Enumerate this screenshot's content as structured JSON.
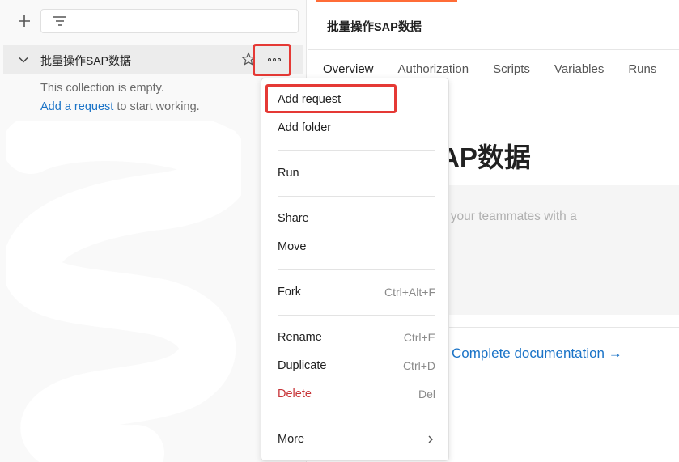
{
  "sidebar": {
    "collection_name": "批量操作SAP数据",
    "empty_message": "This collection is empty.",
    "add_request_link": "Add a request",
    "empty_suffix": " to start working."
  },
  "main": {
    "title": "批量操作SAP数据",
    "tabs": [
      {
        "label": "Overview"
      },
      {
        "label": "Authorization"
      },
      {
        "label": "Scripts"
      },
      {
        "label": "Variables"
      },
      {
        "label": "Runs"
      }
    ],
    "big_title": "批量操作SAP数据",
    "description_placeholder": "Make things easier for your teammates with a",
    "doc_link": "Complete documentation →"
  },
  "context_menu": {
    "items": [
      {
        "label": "Add request",
        "shortcut": ""
      },
      {
        "label": "Add folder",
        "shortcut": ""
      },
      {
        "label": "Run",
        "shortcut": ""
      },
      {
        "label": "Share",
        "shortcut": ""
      },
      {
        "label": "Move",
        "shortcut": ""
      },
      {
        "label": "Fork",
        "shortcut": "Ctrl+Alt+F"
      },
      {
        "label": "Rename",
        "shortcut": "Ctrl+E"
      },
      {
        "label": "Duplicate",
        "shortcut": "Ctrl+D"
      },
      {
        "label": "Delete",
        "shortcut": "Del"
      },
      {
        "label": "More",
        "shortcut": ""
      }
    ]
  },
  "colors": {
    "accent": "#ff6c37",
    "link": "#1a73c7",
    "danger": "#c8363a",
    "highlight": "#e53935"
  }
}
